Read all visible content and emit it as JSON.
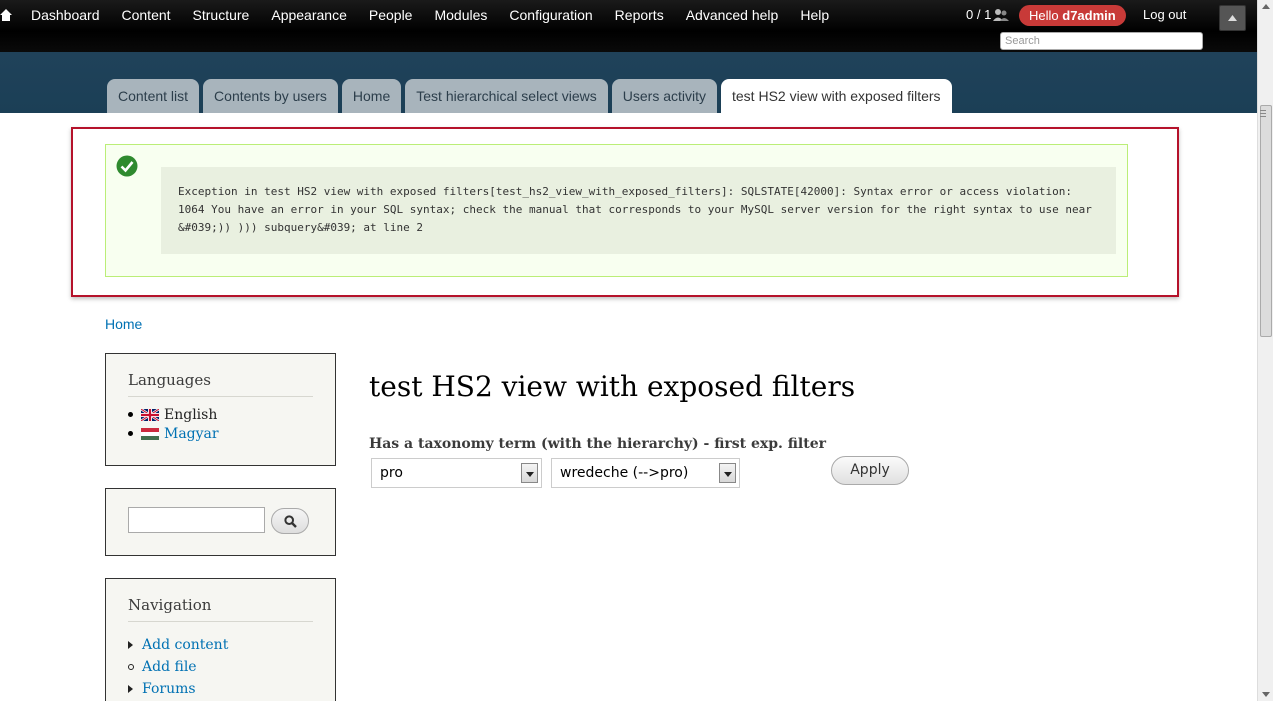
{
  "toolbar": {
    "menu": [
      "Dashboard",
      "Content",
      "Structure",
      "Appearance",
      "People",
      "Modules",
      "Configuration",
      "Reports",
      "Advanced help",
      "Help"
    ],
    "user_count": "0 / 1",
    "hello_prefix": "Hello ",
    "username": "d7admin",
    "logout": "Log out",
    "search_placeholder": "Search"
  },
  "tabs": [
    "Content list",
    "Contents by users",
    "Home",
    "Test hierarchical select views",
    "Users activity",
    "test HS2 view with exposed filters"
  ],
  "message": {
    "text": "Exception in test HS2 view with exposed filters[test_hs2_view_with_exposed_filters]: SQLSTATE[42000]: Syntax error or access violation: 1064 You have an error in your SQL syntax; check the manual that corresponds to your MySQL server version for the right syntax to use near &#039;)) ))) subquery&#039; at line 2"
  },
  "breadcrumb": "Home",
  "languages": {
    "title": "Languages",
    "items": [
      "English",
      "Magyar"
    ]
  },
  "navigation": {
    "title": "Navigation",
    "items": [
      "Add content",
      "Add file",
      "Forums"
    ]
  },
  "main": {
    "title": "test HS2 view with exposed filters",
    "filter_label": "Has a taxonomy term (with the hierarchy) - first exp. filter",
    "select1_value": "pro",
    "select2_value": "wredeche (-->pro)",
    "apply": "Apply"
  },
  "colors": {
    "toolbar_bg": "#000000",
    "header_bg": "#1f4158",
    "hello_badge": "#c83a38",
    "error_frame": "#b5122b",
    "link": "#0071b3"
  }
}
